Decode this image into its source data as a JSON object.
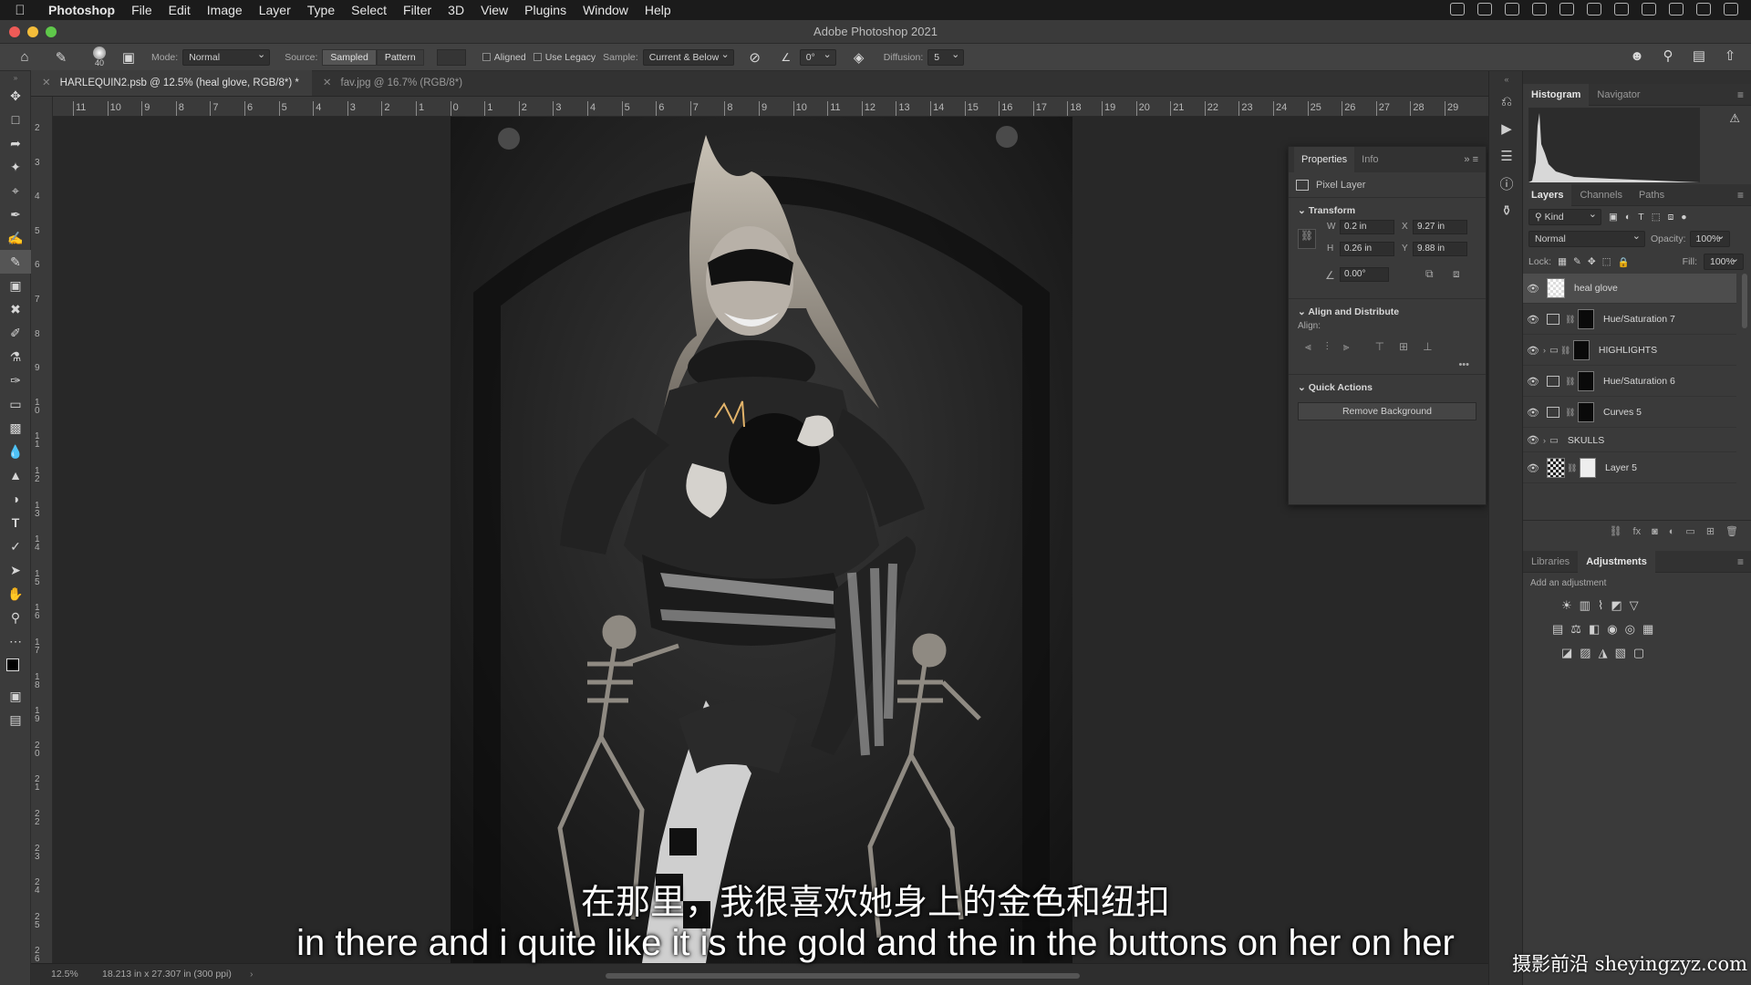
{
  "menubar": {
    "app": "Photoshop",
    "items": [
      "File",
      "Edit",
      "Image",
      "Layer",
      "Type",
      "Select",
      "Filter",
      "3D",
      "View",
      "Plugins",
      "Window",
      "Help"
    ]
  },
  "window_title": "Adobe Photoshop 2021",
  "options": {
    "brush_size": "40",
    "mode_label": "Mode:",
    "mode_value": "Normal",
    "source_label": "Source:",
    "source_sampled": "Sampled",
    "source_pattern": "Pattern",
    "aligned": "Aligned",
    "use_legacy": "Use Legacy",
    "sample_label": "Sample:",
    "sample_value": "Current & Below",
    "angle": "0°",
    "diffusion_label": "Diffusion:",
    "diffusion_value": "5"
  },
  "tabs": [
    {
      "label": "HARLEQUIN2.psb @ 12.5% (heal glove, RGB/8*) *"
    },
    {
      "label": "fav.jpg @ 16.7% (RGB/8*)"
    }
  ],
  "ruler_h": [
    "11",
    "10",
    "9",
    "8",
    "7",
    "6",
    "5",
    "4",
    "3",
    "2",
    "1",
    "0",
    "1",
    "2",
    "3",
    "4",
    "5",
    "6",
    "7",
    "8",
    "9",
    "10",
    "11",
    "12",
    "13",
    "14",
    "15",
    "16",
    "17",
    "18",
    "19",
    "20",
    "21",
    "22",
    "23",
    "24",
    "25",
    "26",
    "27",
    "28",
    "29"
  ],
  "ruler_v": [
    "2",
    "3",
    "4",
    "5",
    "6",
    "7",
    "8",
    "9",
    "10",
    "11",
    "12",
    "13",
    "14",
    "15",
    "16",
    "17",
    "18",
    "19",
    "20",
    "21",
    "22",
    "23",
    "24",
    "25",
    "26"
  ],
  "status": {
    "zoom": "12.5%",
    "dims": "18.213 in x 27.307 in (300 ppi)"
  },
  "properties": {
    "tab_properties": "Properties",
    "tab_info": "Info",
    "layer_type": "Pixel Layer",
    "transform_title": "Transform",
    "w_label": "W",
    "w_value": "0.2 in",
    "x_label": "X",
    "x_value": "9.27 in",
    "h_label": "H",
    "h_value": "0.26 in",
    "y_label": "Y",
    "y_value": "9.88 in",
    "angle_value": "0.00°",
    "align_title": "Align and Distribute",
    "align_label": "Align:",
    "quick_title": "Quick Actions",
    "remove_bg": "Remove Background"
  },
  "histogram": {
    "tab_histogram": "Histogram",
    "tab_navigator": "Navigator"
  },
  "layers_panel": {
    "tab_layers": "Layers",
    "tab_channels": "Channels",
    "tab_paths": "Paths",
    "kind": "Kind",
    "blend": "Normal",
    "opacity_label": "Opacity:",
    "opacity_value": "100%",
    "lock_label": "Lock:",
    "fill_label": "Fill:",
    "fill_value": "100%",
    "layers": [
      {
        "name": "heal glove"
      },
      {
        "name": "Hue/Saturation 7"
      },
      {
        "name": "HIGHLIGHTS"
      },
      {
        "name": "Hue/Saturation 6"
      },
      {
        "name": "Curves 5"
      },
      {
        "name": "SKULLS"
      },
      {
        "name": "Layer 5"
      }
    ]
  },
  "adjustments_panel": {
    "tab_libraries": "Libraries",
    "tab_adjustments": "Adjustments",
    "hint": "Add an adjustment"
  },
  "subtitles": {
    "chinese": "在那里，我很喜欢她身上的金色和纽扣",
    "english": "in there and i quite like it is the gold and the in the buttons on her on her"
  },
  "watermark": "摄影前沿 sheyingzyz.com"
}
